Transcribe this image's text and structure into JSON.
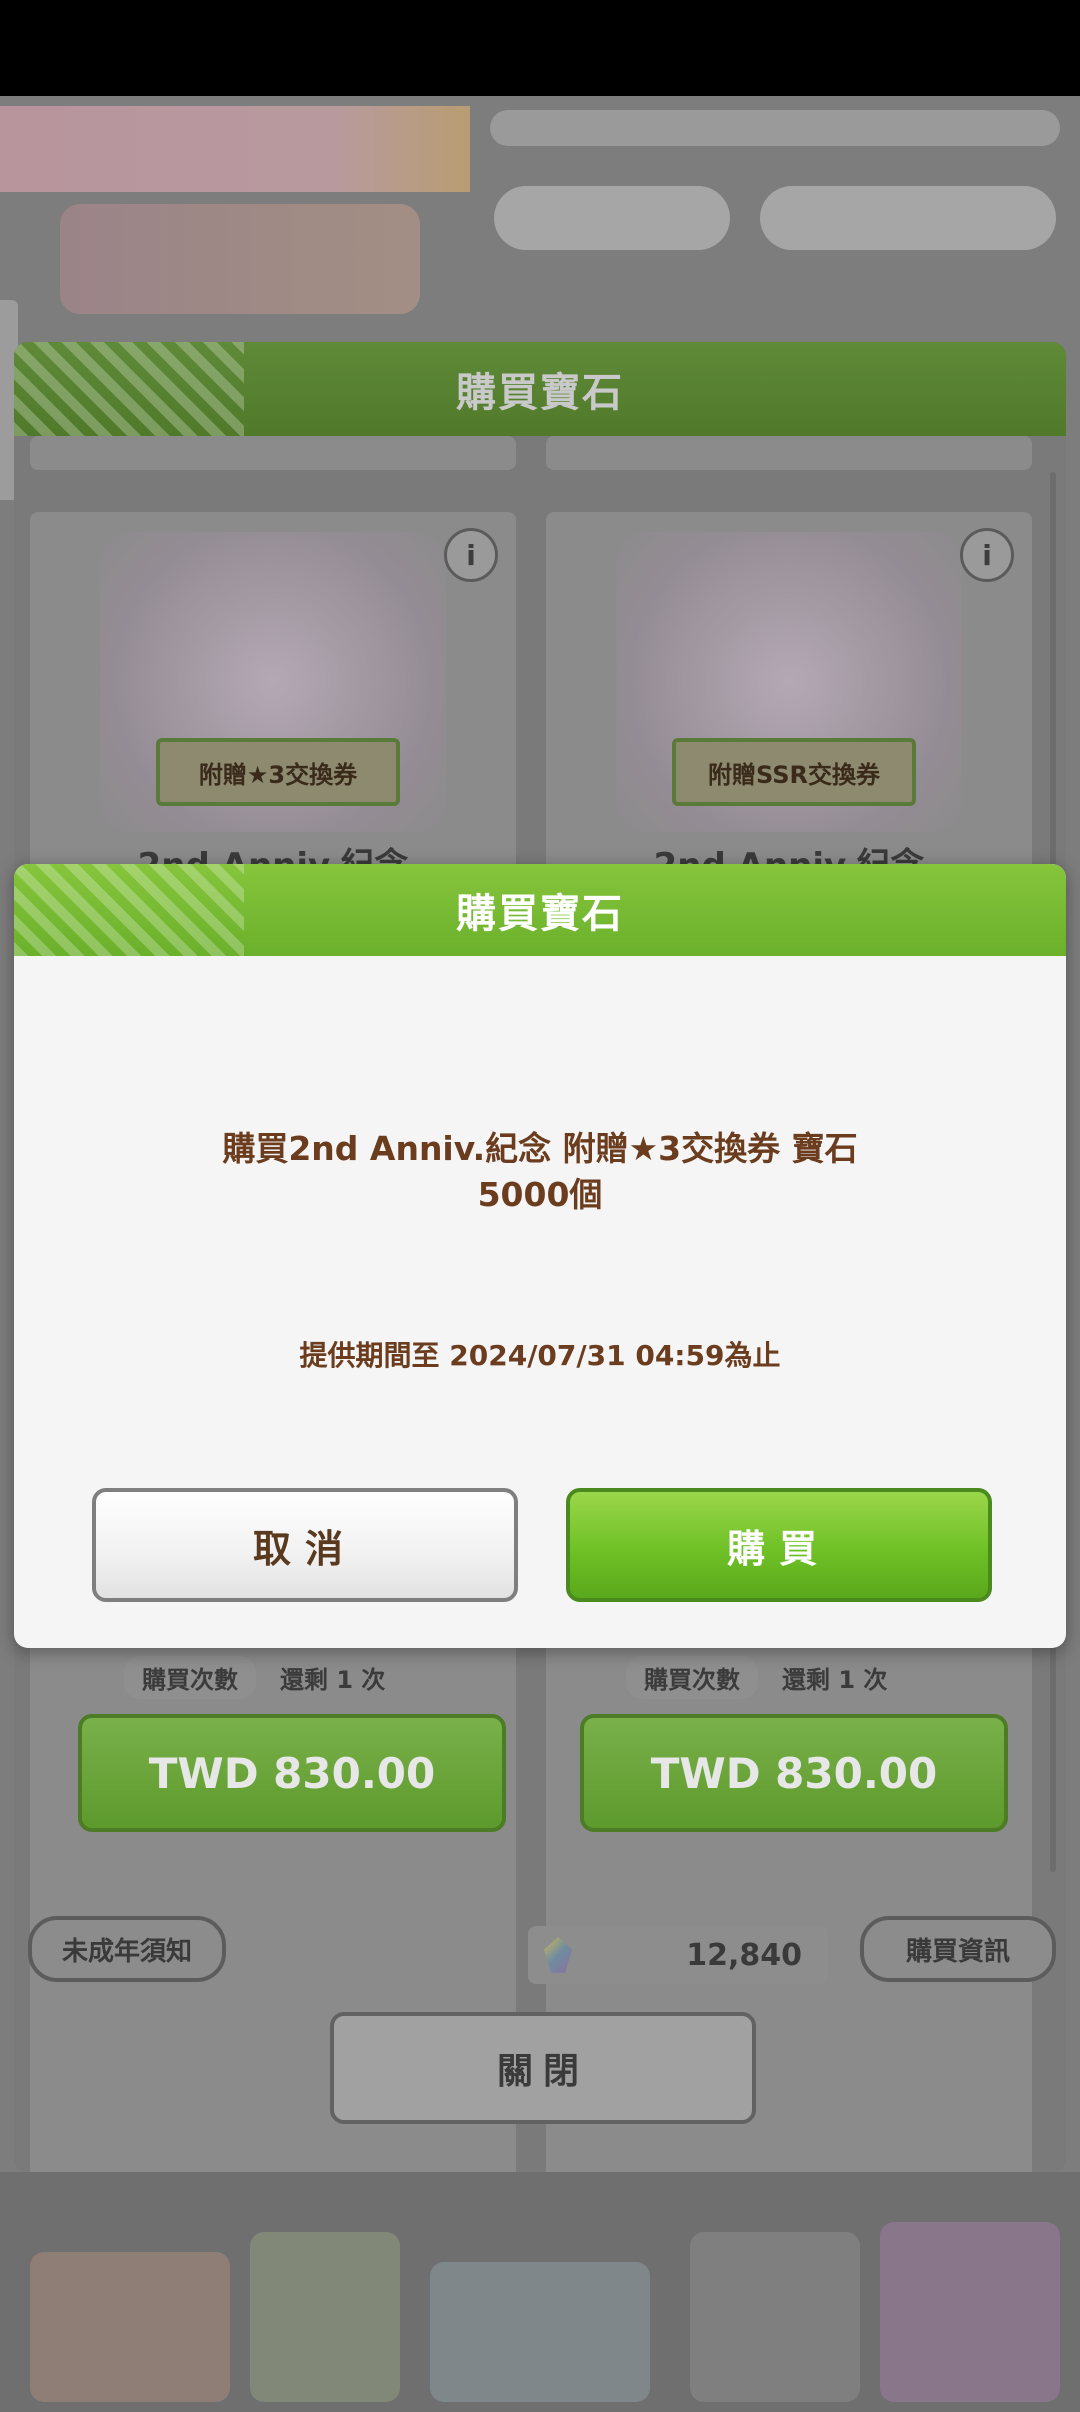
{
  "back_dialog": {
    "title": "購買寶石",
    "cards": [
      {
        "ticket": "附贈★3交換券",
        "subtitle": "2nd Anniv.紀念",
        "count_label": "購買次數",
        "count_value": "還剩 1 次",
        "price": "TWD 830.00"
      },
      {
        "ticket": "附贈SSR交換券",
        "subtitle": "2nd Anniv.紀念",
        "count_label": "購買次數",
        "count_value": "還剩 1 次",
        "price": "TWD 830.00"
      }
    ],
    "minor_notice": "未成年須知",
    "gem_balance": "12,840",
    "purchase_info": "購買資訊",
    "close_label": "關閉"
  },
  "confirm_dialog": {
    "title": "購買寶石",
    "message_line1": "購買2nd Anniv.紀念 附贈★3交換券 寶石",
    "message_line2": "5000個",
    "period": "提供期間至 2024/07/31 04:59為止",
    "cancel_label": "取消",
    "buy_label": "購買"
  },
  "colors": {
    "accent_green": "#6fc126",
    "text_brown": "#6b3d1e"
  }
}
